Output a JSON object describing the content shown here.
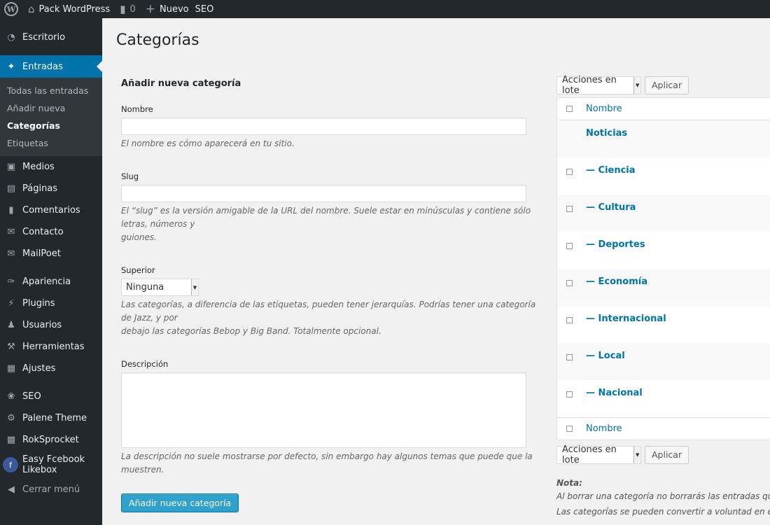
{
  "adminbar": {
    "site_name": "Pack WordPress",
    "comments_count": "0",
    "new_label": "Nuevo",
    "seo_label": "SEO"
  },
  "sidebar": {
    "items": [
      {
        "label": "Escritorio",
        "icon": "dashboard-icon"
      },
      {
        "label": "Entradas",
        "icon": "pin-icon"
      },
      {
        "label": "Medios",
        "icon": "media-icon"
      },
      {
        "label": "Páginas",
        "icon": "pages-icon"
      },
      {
        "label": "Comentarios",
        "icon": "comments-icon"
      },
      {
        "label": "Contacto",
        "icon": "mail-icon"
      },
      {
        "label": "MailPoet",
        "icon": "mail-icon"
      },
      {
        "label": "Apariencia",
        "icon": "brush-icon"
      },
      {
        "label": "Plugins",
        "icon": "plugin-icon"
      },
      {
        "label": "Usuarios",
        "icon": "user-icon"
      },
      {
        "label": "Herramientas",
        "icon": "wrench-icon"
      },
      {
        "label": "Ajustes",
        "icon": "settings-icon"
      },
      {
        "label": "SEO",
        "icon": "seo-icon"
      },
      {
        "label": "Palene Theme",
        "icon": "gear-icon"
      },
      {
        "label": "RokSprocket",
        "icon": "box-icon"
      },
      {
        "label": "Easy Fcebook Likebox",
        "icon": "facebook-icon"
      },
      {
        "label": "Cerrar menú",
        "icon": "collapse-icon"
      }
    ],
    "submenu": [
      "Todas las entradas",
      "Añadir nueva",
      "Categorías",
      "Etiquetas"
    ]
  },
  "page": {
    "title": "Categorías"
  },
  "form": {
    "title": "Añadir nueva categoría",
    "name_label": "Nombre",
    "name_help": "El nombre es cómo aparecerá en tu sitio.",
    "slug_label": "Slug",
    "slug_help_1": "El “slug” es la versión amigable de la URL del nombre. Suele estar en minúsculas y contiene sólo letras, números y",
    "slug_help_2": "guiones.",
    "parent_label": "Superior",
    "parent_value": "Ninguna",
    "parent_help_1": "Las categorías, a diferencia de las etiquetas, pueden tener jerarquías. Podrías tener una categoría de Jazz, y por",
    "parent_help_2": "debajo las categorías Bebop y Big Band. Totalmente opcional.",
    "desc_label": "Descripción",
    "desc_help": "La descripción no suele mostrarse por defecto, sin embargo hay algunos temas que puede que la muestren.",
    "submit_label": "Añadir nueva categoría"
  },
  "list": {
    "bulk_label": "Acciones en lote",
    "apply_label": "Aplicar",
    "column_name": "Nombre",
    "rows": [
      "Noticias",
      "— Ciencia",
      "— Cultura",
      "— Deportes",
      "— Economía",
      "— Internacional",
      "— Local",
      "— Nacional"
    ],
    "note_title": "Nota:",
    "note_1": "Al borrar una categoría no borrarás las entradas que hay",
    "note_2": "Las categorías se pueden convertir a voluntad en etiqueta"
  },
  "colors": {
    "adminbar_bg": "#23282d",
    "menu_active": "#0073aa",
    "link": "#0073aa",
    "primary_button": "#2ea2cc"
  }
}
